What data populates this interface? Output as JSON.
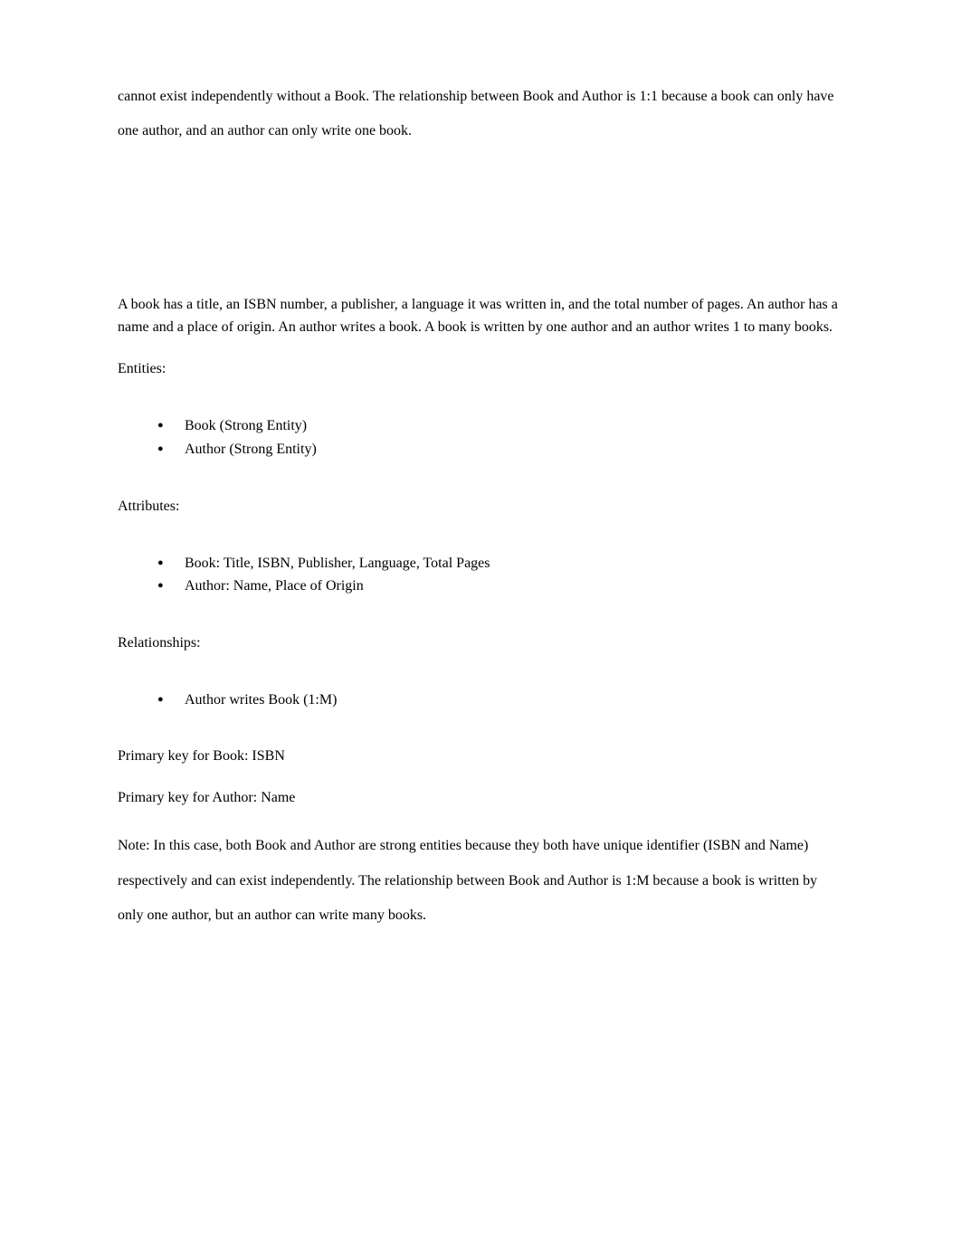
{
  "intro_top": "cannot exist independently without a Book. The relationship between Book and Author is 1:1 because a book can only have one author, and an author can only write one book.",
  "scenario": "A book has a title, an ISBN number, a publisher, a language it was written in, and the total number of pages. An author has a name and a place of origin. An author writes a book. A book is written by one author and an author writes 1 to many books.",
  "entities_heading": "Entities:",
  "entities": [
    "Book (Strong Entity)",
    "Author (Strong Entity)"
  ],
  "attributes_heading": "Attributes:",
  "attributes": [
    "Book: Title, ISBN, Publisher, Language, Total Pages",
    "Author: Name, Place of Origin"
  ],
  "relationships_heading": "Relationships:",
  "relationships": [
    "Author writes Book (1:M)"
  ],
  "pk_book": "Primary key for Book: ISBN",
  "pk_author": "Primary key for Author: Name",
  "note": "Note: In this case, both Book and Author are strong entities because they both have unique identifier (ISBN and Name) respectively and can exist independently. The relationship between Book and Author is 1:M because a book is written by only one author, but an author can write many books."
}
